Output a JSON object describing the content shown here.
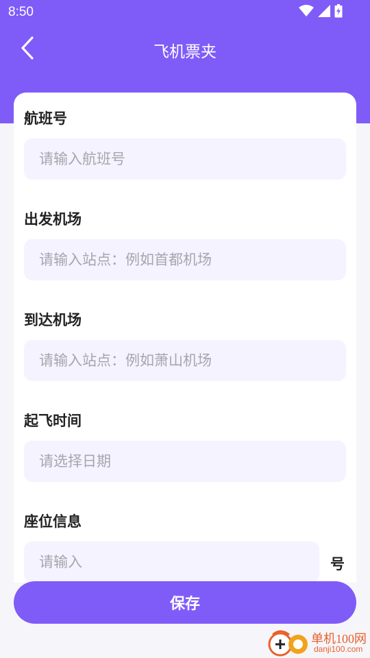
{
  "status_bar": {
    "time": "8:50",
    "icons": [
      "wifi-icon",
      "signal-icon",
      "battery-icon"
    ]
  },
  "nav": {
    "back_icon": "chevron-left-icon",
    "title": "飞机票夹"
  },
  "form": {
    "flight_number": {
      "label": "航班号",
      "placeholder": "请输入航班号",
      "value": ""
    },
    "departure_airport": {
      "label": "出发机场",
      "placeholder": "请输入站点：例如首都机场",
      "value": ""
    },
    "arrival_airport": {
      "label": "到达机场",
      "placeholder": "请输入站点：例如萧山机场",
      "value": ""
    },
    "departure_time": {
      "label": "起飞时间",
      "placeholder": "请选择日期",
      "value": ""
    },
    "seat_info": {
      "label": "座位信息",
      "placeholder": "请输入",
      "value": "",
      "suffix": "号"
    }
  },
  "save_button": {
    "label": "保存"
  },
  "watermark": {
    "site_name": "单机100网",
    "domain": "danji100.com"
  },
  "colors": {
    "primary": "#7f5cf8",
    "input_bg": "#f4f3ff",
    "page_bg": "#f6f6fa",
    "placeholder": "#a6a6ad",
    "watermark": "#e8602c"
  }
}
